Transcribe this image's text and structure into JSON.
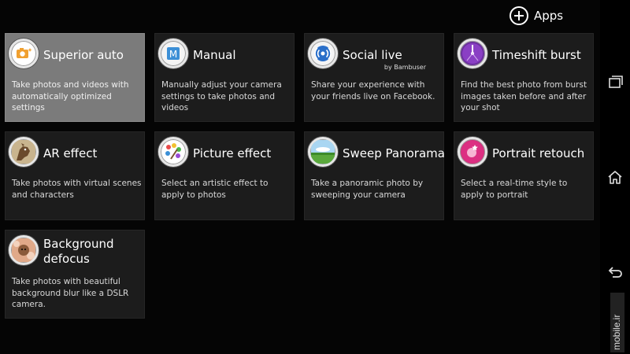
{
  "header": {
    "apps_label": "Apps"
  },
  "tiles": [
    {
      "title": "Superior auto",
      "subtitle": "",
      "desc": "Take photos and videos with automatically optimized settings",
      "icon": "superior-auto-icon",
      "selected": true
    },
    {
      "title": "Manual",
      "subtitle": "",
      "desc": "Manually adjust your camera settings to take photos and videos",
      "icon": "manual-icon"
    },
    {
      "title": "Social live",
      "subtitle": "by Bambuser",
      "desc": "Share your experience with your friends live on Facebook.",
      "icon": "social-live-icon"
    },
    {
      "title": "Timeshift burst",
      "subtitle": "",
      "desc": "Find the best photo from burst images taken before and after your shot",
      "icon": "timeshift-burst-icon"
    },
    {
      "title": "AR effect",
      "subtitle": "",
      "desc": "Take photos with virtual scenes and characters",
      "icon": "ar-effect-icon"
    },
    {
      "title": "Picture effect",
      "subtitle": "",
      "desc": "Select an artistic effect to apply to photos",
      "icon": "picture-effect-icon"
    },
    {
      "title": "Sweep Panorama",
      "subtitle": "",
      "desc": "Take a panoramic photo by sweeping your camera",
      "icon": "sweep-panorama-icon"
    },
    {
      "title": "Portrait retouch",
      "subtitle": "",
      "desc": "Select a real-time style to apply to portrait",
      "icon": "portrait-retouch-icon"
    },
    {
      "title": "Background defocus",
      "subtitle": "",
      "desc": "Take photos with beautiful background blur like a DSLR camera.",
      "icon": "background-defocus-icon"
    }
  ],
  "navbar": {
    "icons": [
      "recent-apps-icon",
      "home-icon",
      "back-icon"
    ]
  },
  "watermark": "mobile.ir",
  "colors": {
    "background": "#050505",
    "tile": "#1c1c1c",
    "tile_selected": "#7b7b7b",
    "text": "#ffffff"
  }
}
